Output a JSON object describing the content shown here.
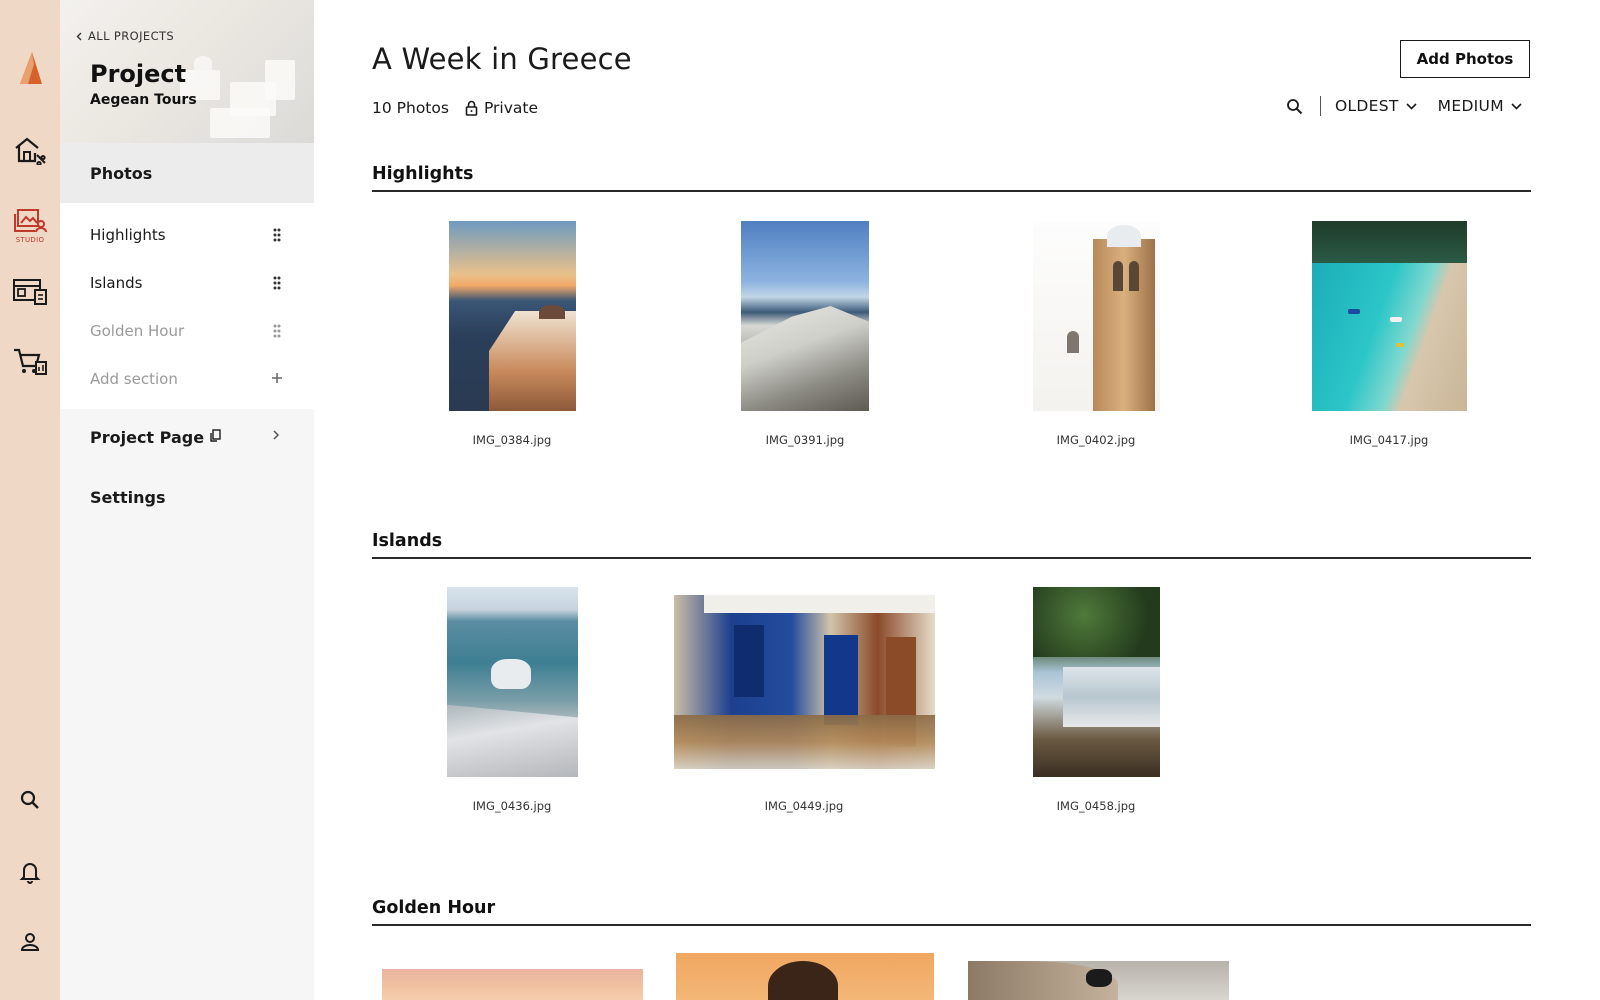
{
  "rail": {
    "studio_label": "STUDIO"
  },
  "sidebar": {
    "back_label": "ALL PROJECTS",
    "project_title": "Project",
    "project_subtitle": "Aegean Tours",
    "photos_label": "Photos",
    "sections": [
      {
        "label": "Highlights",
        "dimmed": false
      },
      {
        "label": "Islands",
        "dimmed": false
      },
      {
        "label": "Golden Hour",
        "dimmed": true
      }
    ],
    "add_section_label": "Add section",
    "project_page_label": "Project Page",
    "settings_label": "Settings"
  },
  "main": {
    "title": "A Week in Greece",
    "photo_count": "10 Photos",
    "privacy": "Private",
    "add_photos_label": "Add Photos",
    "sort_label": "OLDEST",
    "size_label": "MEDIUM",
    "sections": [
      {
        "title": "Highlights",
        "photos": [
          {
            "filename": "IMG_0384.jpg"
          },
          {
            "filename": "IMG_0391.jpg"
          },
          {
            "filename": "IMG_0402.jpg"
          },
          {
            "filename": "IMG_0417.jpg"
          }
        ]
      },
      {
        "title": "Islands",
        "photos": [
          {
            "filename": "IMG_0436.jpg"
          },
          {
            "filename": "IMG_0449.jpg"
          },
          {
            "filename": "IMG_0458.jpg"
          }
        ]
      },
      {
        "title": "Golden Hour",
        "photos": []
      }
    ]
  },
  "colors": {
    "rail_bg": "#efd9c6",
    "accent": "#d4622a",
    "studio_active": "#c0392b"
  }
}
